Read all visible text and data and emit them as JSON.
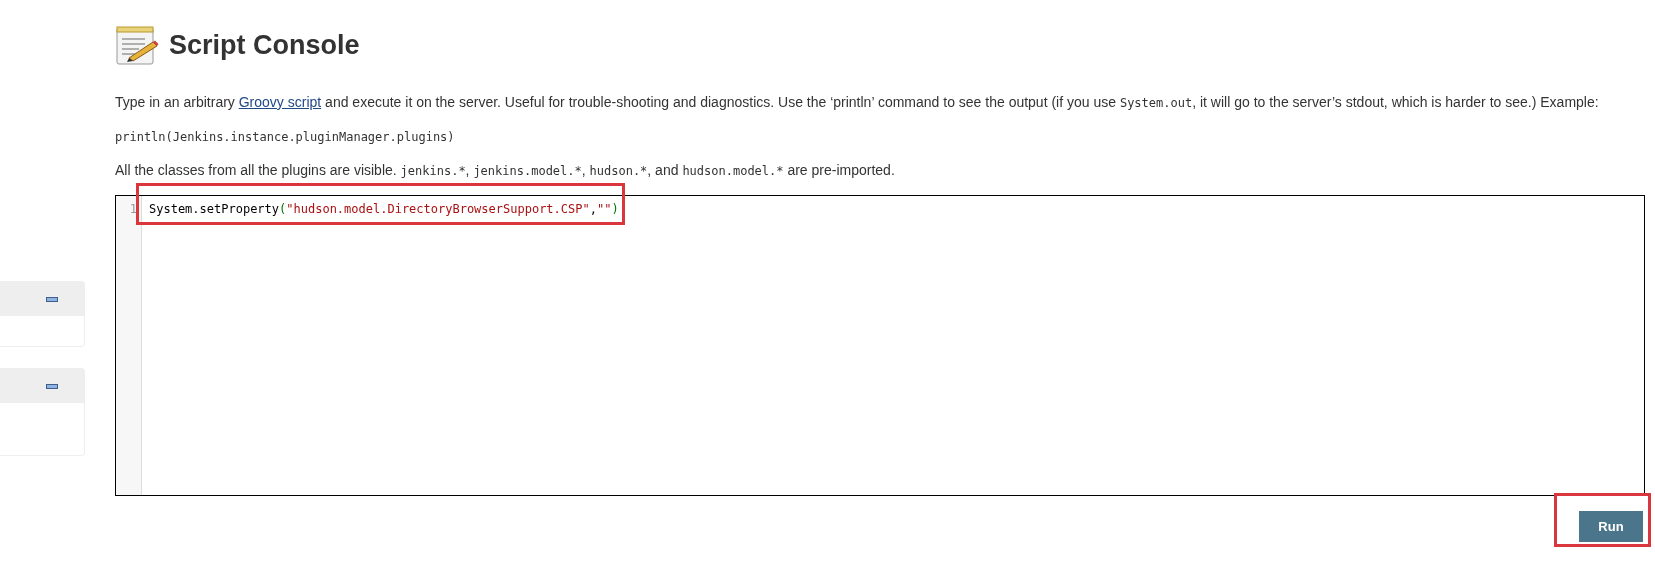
{
  "page": {
    "title": "Script Console"
  },
  "sidebar": {
    "panels": [
      {
        "kind": "short"
      },
      {
        "kind": "tall"
      }
    ]
  },
  "intro": [
    {
      "kind": "text",
      "text": "Type in an arbitrary "
    },
    {
      "kind": "link",
      "text": "Groovy script"
    },
    {
      "kind": "text",
      "text": " and execute it on the server. Useful for trouble-shooting and diagnostics. Use the ‘println’ command to see the output (if you use "
    },
    {
      "kind": "code",
      "text": "System.out"
    },
    {
      "kind": "text",
      "text": ", it will go to the server’s stdout, which is harder to see.) Example:"
    }
  ],
  "example": "println(Jenkins.instance.pluginManager.plugins)",
  "imports": [
    {
      "kind": "text",
      "text": "All the classes from all the plugins are visible. "
    },
    {
      "kind": "code",
      "text": "jenkins.*"
    },
    {
      "kind": "text",
      "text": ", "
    },
    {
      "kind": "code",
      "text": "jenkins.model.*"
    },
    {
      "kind": "text",
      "text": ", "
    },
    {
      "kind": "code",
      "text": "hudson.*"
    },
    {
      "kind": "text",
      "text": ", and "
    },
    {
      "kind": "code",
      "text": "hudson.model.*"
    },
    {
      "kind": "text",
      "text": " are pre-imported."
    }
  ],
  "editor": {
    "lines": [
      {
        "number": "1",
        "tokens": [
          {
            "kind": "plain",
            "text": "System.setProperty"
          },
          {
            "kind": "bracket",
            "text": "("
          },
          {
            "kind": "string",
            "text": "\"hudson.model.DirectoryBrowserSupport.CSP\""
          },
          {
            "kind": "plain",
            "text": ","
          },
          {
            "kind": "string",
            "text": "\"\""
          },
          {
            "kind": "bracket",
            "text": ")"
          }
        ]
      }
    ]
  },
  "run_button": "Run"
}
